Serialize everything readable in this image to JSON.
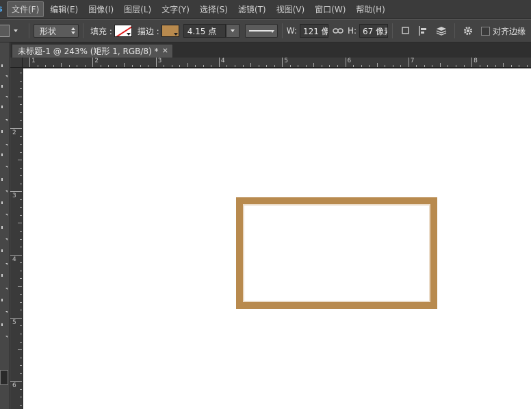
{
  "menubar": {
    "logo": "s",
    "items": [
      {
        "label": "文件(F)",
        "active": true
      },
      {
        "label": "编辑(E)"
      },
      {
        "label": "图像(I)"
      },
      {
        "label": "图层(L)"
      },
      {
        "label": "文字(Y)"
      },
      {
        "label": "选择(S)"
      },
      {
        "label": "滤镜(T)"
      },
      {
        "label": "视图(V)"
      },
      {
        "label": "窗口(W)"
      },
      {
        "label": "帮助(H)"
      }
    ]
  },
  "options": {
    "mode": "形状",
    "fill_label": "填充 :",
    "stroke_label": "描边 :",
    "stroke_color": "#b88a4e",
    "stroke_width": "4.15 点",
    "w_label": "W:",
    "w_value": "121 像素",
    "link_icon": "link-icon",
    "h_label": "H:",
    "h_value": "67 像素",
    "align_edges_label": "对齐边缘"
  },
  "document": {
    "tab_title": "未标题-1 @ 243% (矩形 1, RGB/8) *",
    "close": "×"
  },
  "rulers": {
    "horizontal": [
      "1",
      "2",
      "3",
      "4",
      "5",
      "6",
      "7",
      "8"
    ],
    "vertical": [
      "2",
      "3",
      "4",
      "5",
      "6"
    ]
  },
  "canvas": {
    "background": "#ffffff",
    "shape_stroke": "#b88a4e"
  }
}
